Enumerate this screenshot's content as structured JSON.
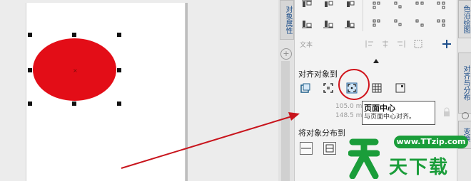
{
  "docker": {
    "side_tab_left": "对象属性",
    "right_tabs": [
      "色沿绘图",
      "对齐与分布",
      "变换"
    ],
    "faded_toolbar": "文本",
    "align_to_label": "对齐对象到",
    "distribute_to_label": "将对象分布到",
    "coords": [
      "105.0 m",
      "148.5 m"
    ]
  },
  "tooltip": {
    "title": "页面中心",
    "description": "与页面中心对齐。"
  },
  "watermark": {
    "site": "www.TTzip.com",
    "name": "天下载"
  },
  "colors": {
    "ellipse": "#e30d17",
    "highlight": "#d0121a",
    "watermark": "#1a9d3a"
  }
}
